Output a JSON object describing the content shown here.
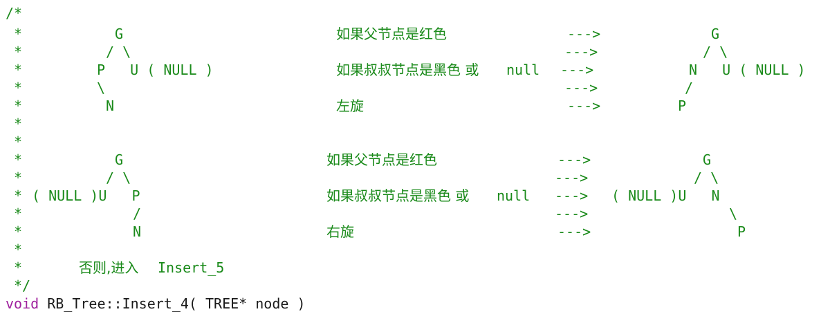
{
  "comment": {
    "open": "/*",
    "star": "*",
    "close": "*/"
  },
  "diagram1": {
    "left": {
      "g": "G",
      "branch1": "/ \\",
      "row": "P   U ( NULL )",
      "branch2": "\\",
      "n": "N"
    },
    "desc": {
      "line1": "如果父节点是红色",
      "line3_cn": "如果叔叔节点是黑色 或",
      "line3_en": "null",
      "line5": "左旋"
    },
    "arrows": [
      "--->",
      "--->",
      "--->",
      "--->",
      "--->"
    ],
    "right": {
      "g": "G",
      "branch1": "/ \\",
      "row": "N   U ( NULL )",
      "branch2": "/",
      "p": "P"
    }
  },
  "diagram2": {
    "left": {
      "g": "G",
      "branch1": "/ \\",
      "row": "( NULL )U   P",
      "branch2": "/",
      "n": "N"
    },
    "desc": {
      "line1": "如果父节点是红色",
      "line3_cn": "如果叔叔节点是黑色 或",
      "line3_en": "null",
      "line5": "右旋"
    },
    "arrows": [
      "--->",
      "--->",
      "--->",
      "--->",
      "--->"
    ],
    "right": {
      "g": "G",
      "branch1": "/ \\",
      "row": "( NULL )U   N",
      "branch2": "\\",
      "p": "P"
    }
  },
  "footer": {
    "else_cn": "否则,进入",
    "else_en": "Insert_5"
  },
  "signature": {
    "keyword": "void",
    "rest": "RB_Tree::Insert_4( TREE* node )"
  }
}
